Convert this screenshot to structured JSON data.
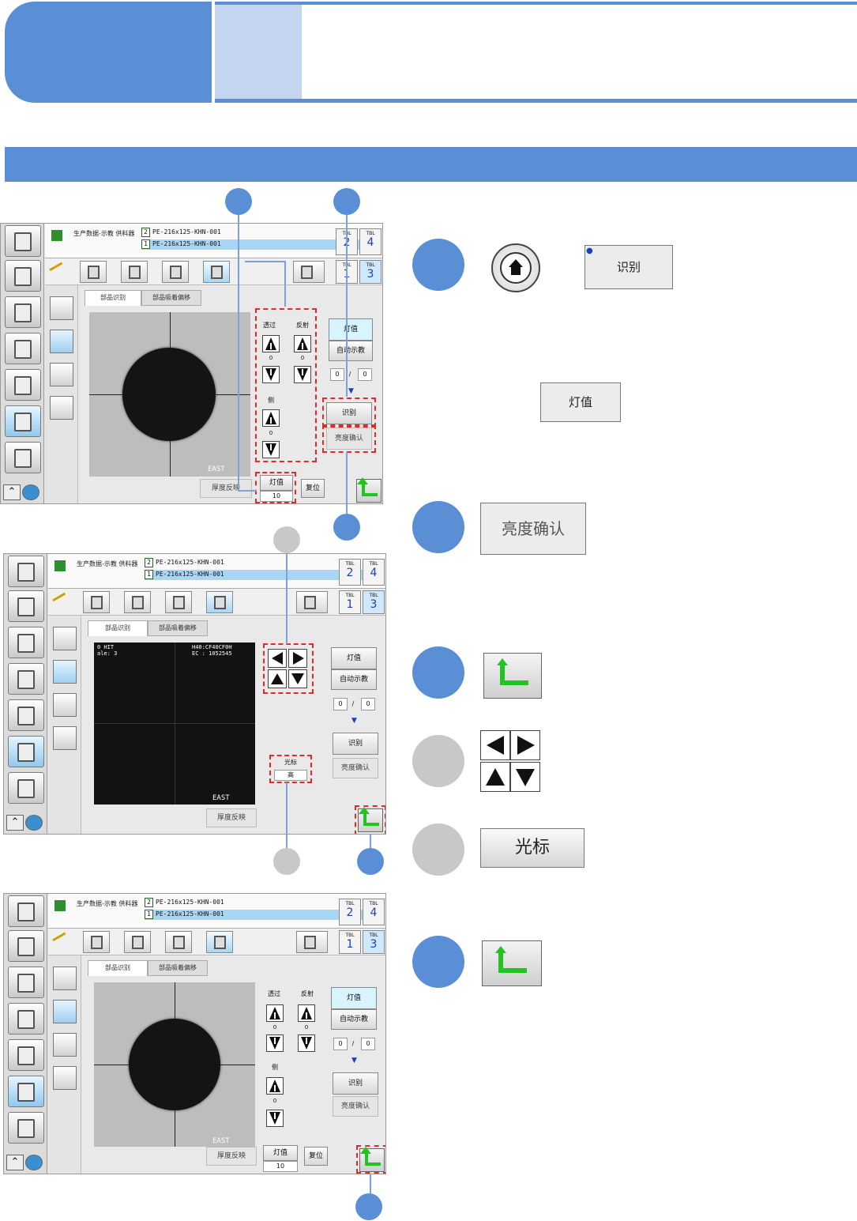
{
  "screen": {
    "feeder_info": "生产数据-示教 供料器",
    "pe_line_1": "PE-216x125-KHN-001",
    "pe_line_2": "PE-216x125-KHN-001",
    "pe_icon_1": "2",
    "pe_icon_2": "1",
    "tbl_label": "TBL",
    "tbl_2": "2",
    "tbl_4": "4",
    "tbl_1": "1",
    "tbl_3": "3",
    "tab_component_recognition": "部品识别",
    "tab_pickup_offset": "部品吸着偏移",
    "transmit": "透过",
    "reflect": "反射",
    "side": "侧",
    "zero": "0",
    "lamp_value": "灯值",
    "auto_teach": "自动示教",
    "counter_left": "0",
    "counter_sep": "/",
    "counter_right": "0",
    "recognize": "识别",
    "brightness_confirm": "亮度确认",
    "thickness_reflect": "厚度反映",
    "lamp_value_number": "10",
    "reset": "复位",
    "east": "EAST",
    "cursor": "光标",
    "cursor_value": "高",
    "overlay_left_1": "0 HIT",
    "overlay_left_2": "ale: 3",
    "overlay_right_1": "H40:CF40CF0H",
    "overlay_right_2": "EC : 1052545"
  },
  "instructions": {
    "recognize_button": "识别",
    "lamp_value_button": "灯值",
    "brightness_confirm_button": "亮度确认",
    "cursor_button": "光标"
  },
  "colors": {
    "accent_blue": "#5a8fd6",
    "light_blue": "#c4d6ef",
    "marker_gray": "#c8c8c8",
    "highlight_red": "#e12a2a",
    "return_green": "#22c422"
  },
  "icons": [
    "home-icon",
    "robot-icon",
    "production-data-icon",
    "chart-icon",
    "alarm-clock-icon",
    "teach-icon",
    "machine-icon",
    "double-chevron-up-icon",
    "globe-icon",
    "link-icon",
    "return-arrow-icon",
    "shift-key-icon",
    "arrow-left-icon",
    "arrow-right-icon",
    "arrow-up-icon",
    "arrow-down-icon"
  ]
}
